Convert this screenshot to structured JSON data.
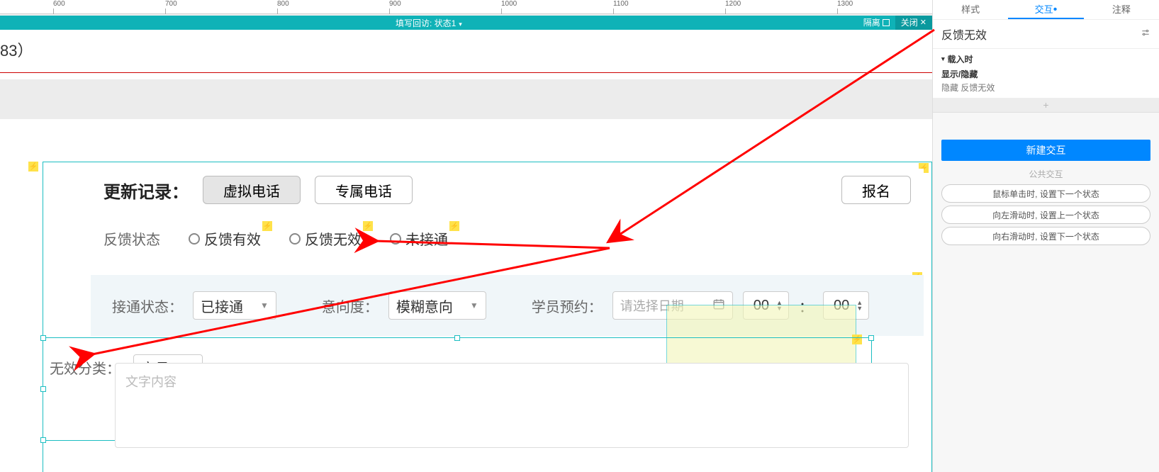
{
  "ruler": {
    "marks": [
      "600",
      "700",
      "800",
      "900",
      "1000",
      "1100",
      "1200",
      "1300"
    ]
  },
  "stateBar": {
    "title": "填写回访: 状态1",
    "isolate": "隔离",
    "close": "关闭"
  },
  "corner": "83）",
  "card": {
    "header": "更新记录：",
    "btnVirtual": "虚拟电话",
    "btnPrivate": "专属电话",
    "btnSignup": "报名",
    "feedbackLabel": "反馈状态",
    "radio1": "反馈有效",
    "radio2": "反馈无效",
    "radio3": "未接通",
    "connLabel": "接通状态：",
    "connValue": "已接通",
    "intentLabel": "意向度：",
    "intentValue": "模糊意向",
    "apptLabel": "学员预约：",
    "datePh": "请选择日期",
    "hour": "00",
    "colon": "：",
    "minute": "00",
    "invalidLabel": "无效分类：",
    "invalidValue": "空号",
    "textareaPh": "文字内容"
  },
  "inspector": {
    "tabStyle": "样式",
    "tabInteract": "交互",
    "tabNote": "注释",
    "componentName": "反馈无效",
    "eventTitle": "载入时",
    "actionTitle": "显示/隐藏",
    "actionDetail": "隐藏 反馈无效",
    "newInteract": "新建交互",
    "publicLabel": "公共交互",
    "pill1": "鼠标单击时, 设置下一个状态",
    "pill2": "向左滑动时, 设置上一个状态",
    "pill3": "向右滑动时, 设置下一个状态"
  }
}
